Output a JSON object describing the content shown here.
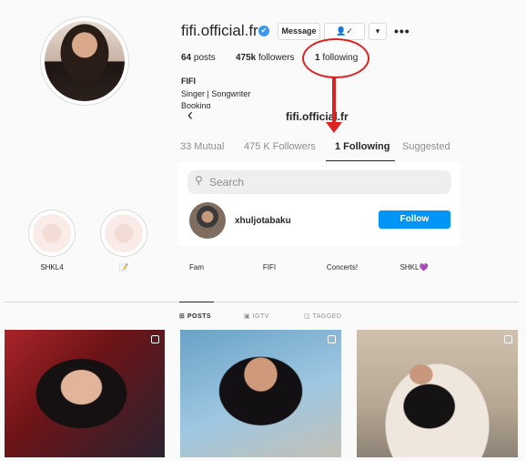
{
  "profile": {
    "username": "fifi.official.fr",
    "verified_mark": "✔",
    "message_label": "Message",
    "following_icon": "👤✓",
    "dropdown_icon": "▾",
    "more_icon": "•••",
    "stats": {
      "posts_count": "64",
      "posts_label": "posts",
      "followers_count": "475k",
      "followers_label": "followers",
      "following_count": "1",
      "following_label": "following"
    },
    "full_name": "FIFI",
    "bio_line1": "Singer | Songwriter",
    "bio_line2": "Booking"
  },
  "annotation": {
    "highlight_color": "#dd2222"
  },
  "modal": {
    "back_icon": "‹",
    "title": "fifi.official.fr",
    "tabs": [
      {
        "label": "33 Mutual"
      },
      {
        "label": "475 K Followers"
      },
      {
        "label": "1 Following"
      },
      {
        "label": "Suggested"
      }
    ],
    "search_placeholder": "Search",
    "rows": [
      {
        "username": "xhuljotabaku",
        "button_label": "Follow"
      }
    ]
  },
  "highlights": [
    {
      "label": "SHKL4"
    },
    {
      "label": "📝"
    },
    {
      "label": "Fam"
    },
    {
      "label": "FIFI"
    },
    {
      "label": "Concerts!"
    },
    {
      "label": "SHKL💜"
    }
  ],
  "post_tabs": [
    {
      "icon": "⊞",
      "label": "POSTS"
    },
    {
      "icon": "▣",
      "label": "IGTV"
    },
    {
      "icon": "◫",
      "label": "TAGGED"
    }
  ],
  "colors": {
    "accent": "#0095f6",
    "annotation": "#dd2222"
  }
}
